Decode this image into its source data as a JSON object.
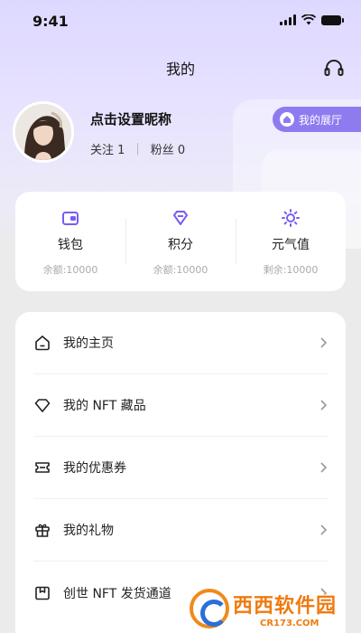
{
  "status_bar": {
    "time": "9:41"
  },
  "header": {
    "title": "我的",
    "service_icon": "headset-icon"
  },
  "profile": {
    "nickname": "点击设置昵称",
    "following": "关注 1",
    "separator": "|",
    "followers": "粉丝 0",
    "gallery_button": "我的展厅"
  },
  "stats": [
    {
      "icon": "wallet-icon",
      "label": "钱包",
      "sub": "余额:10000"
    },
    {
      "icon": "diamond-icon",
      "label": "积分",
      "sub": "余额:10000"
    },
    {
      "icon": "sun-icon",
      "label": "元气值",
      "sub": "剩余:10000"
    }
  ],
  "menu": [
    {
      "icon": "home-icon",
      "label": "我的主页"
    },
    {
      "icon": "gem-icon",
      "label": "我的 NFT 藏品"
    },
    {
      "icon": "coupon-icon",
      "label": "我的优惠券"
    },
    {
      "icon": "gift-icon",
      "label": "我的礼物"
    },
    {
      "icon": "issue-icon",
      "label": "创世 NFT 发货通道"
    }
  ],
  "colors": {
    "accent": "#7b5cf0",
    "gallery_button": "#8f7bf0"
  },
  "watermark": {
    "main": "西西软件园",
    "sub": "CR173.COM"
  }
}
